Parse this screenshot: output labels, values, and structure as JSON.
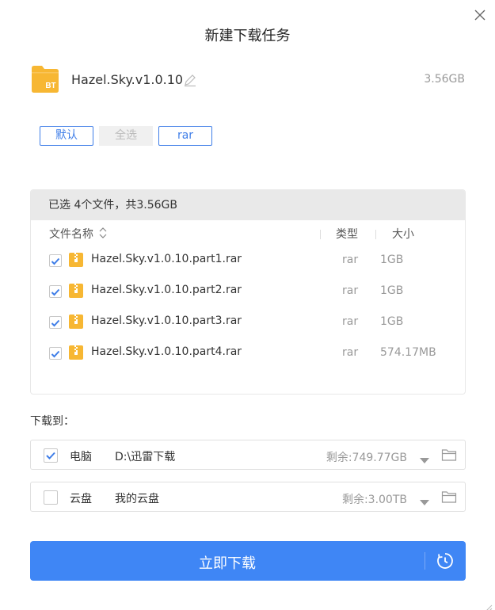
{
  "dialog": {
    "title": "新建下载任务",
    "close_icon": "close-icon"
  },
  "task": {
    "name": "Hazel.Sky.v1.0.10",
    "size": "3.56GB",
    "icon_text": "BT",
    "icon_color": "#f7b733"
  },
  "filters": {
    "default_label": "默认",
    "select_all_label": "全选",
    "rar_label": "rar"
  },
  "file_list": {
    "summary": "已选 4个文件，共3.56GB",
    "columns": {
      "name": "文件名称",
      "type": "类型",
      "size": "大小"
    },
    "files": [
      {
        "name": "Hazel.Sky.v1.0.10.part1.rar",
        "type": "rar",
        "size": "1GB",
        "checked": true
      },
      {
        "name": "Hazel.Sky.v1.0.10.part2.rar",
        "type": "rar",
        "size": "1GB",
        "checked": true
      },
      {
        "name": "Hazel.Sky.v1.0.10.part3.rar",
        "type": "rar",
        "size": "1GB",
        "checked": true
      },
      {
        "name": "Hazel.Sky.v1.0.10.part4.rar",
        "type": "rar",
        "size": "574.17MB",
        "checked": true
      }
    ]
  },
  "download_to": {
    "label": "下载到：",
    "destinations": [
      {
        "name": "电脑",
        "path": "D:\\迅雷下载",
        "free": "剩余:749.77GB",
        "checked": true
      },
      {
        "name": "云盘",
        "path": "我的云盘",
        "free": "剩余:3.00TB",
        "checked": false
      }
    ]
  },
  "action": {
    "download_now": "立即下载"
  },
  "colors": {
    "accent": "#3f86f5",
    "check_blue": "#3f7ee8",
    "folder_yellow": "#f7b733"
  }
}
